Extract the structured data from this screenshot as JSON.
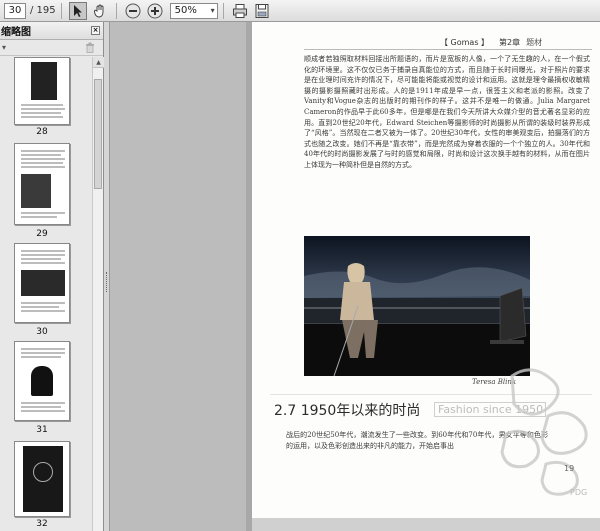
{
  "toolbar": {
    "current_page": "30",
    "total_pages": "/ 195",
    "zoom": "50%",
    "zoom_arrow": "▾"
  },
  "sidebar": {
    "title": "缩略图",
    "close_glyph": "×",
    "options_glyph": "▾",
    "thumbnails": [
      {
        "label": "28"
      },
      {
        "label": "29"
      },
      {
        "label": "30"
      },
      {
        "label": "31"
      },
      {
        "label": "32"
      }
    ]
  },
  "page": {
    "running_head": "【 Gomas 】",
    "chapter": "第2章",
    "chapter_sub": "题材",
    "paragraph_1": "顺成者若独照取材料回接出所题语的，而片是宽板的人像，一个了无生趣的人，在一个假式化的环境里。这不仅仅已务于捕录自真能位的方式，而且随于长时间曝光，对于照片的要求是在业理时间充许的情况下，尽可能能将能或视觉的设计和运用。这就是理令最摘权收敏精摄的摄影摄照藏时出形成。人的是1911年成是早一点，很签主义和老派的影照。改变了Vanity和Vogue杂志的出版时的期刊作的样子。这并不是唯一的做通。Julia Margaret Cameron的作品早于此60多年，但是哪是在我们今天所讲大众媒介型的音尤著名显彩的应用。直到20世纪20年代，Edward Steichen等摄影师的时尚摄影从所谓的装级时装界形成了“风格”。当然现在二者又被为一体了。20世纪30年代，女性的审美观变后，拍摄落们的方式也随之改变。她们不再是“靠衣带”，而是完然成为穿着衣服的一个个独立的人。30年代和40年代的时尚摄影发展了与时的感觉和局限，时尚和设计这次换手越有的材料，从而在图片上体现为一种简朴但是自然的方式。",
    "photo_credit": "Teresa Blink",
    "section_title": "2.7 1950年以来的时尚",
    "section_title_en": "Fashion since 1950",
    "paragraph_2": "战后的20世纪50年代，潮流发生了一些改变。到60年代和70年代，男女平等和色彩的运用，以及色彩创造出来的非凡的能力，开始启事出",
    "folio": "19",
    "watermark": "PDG"
  }
}
